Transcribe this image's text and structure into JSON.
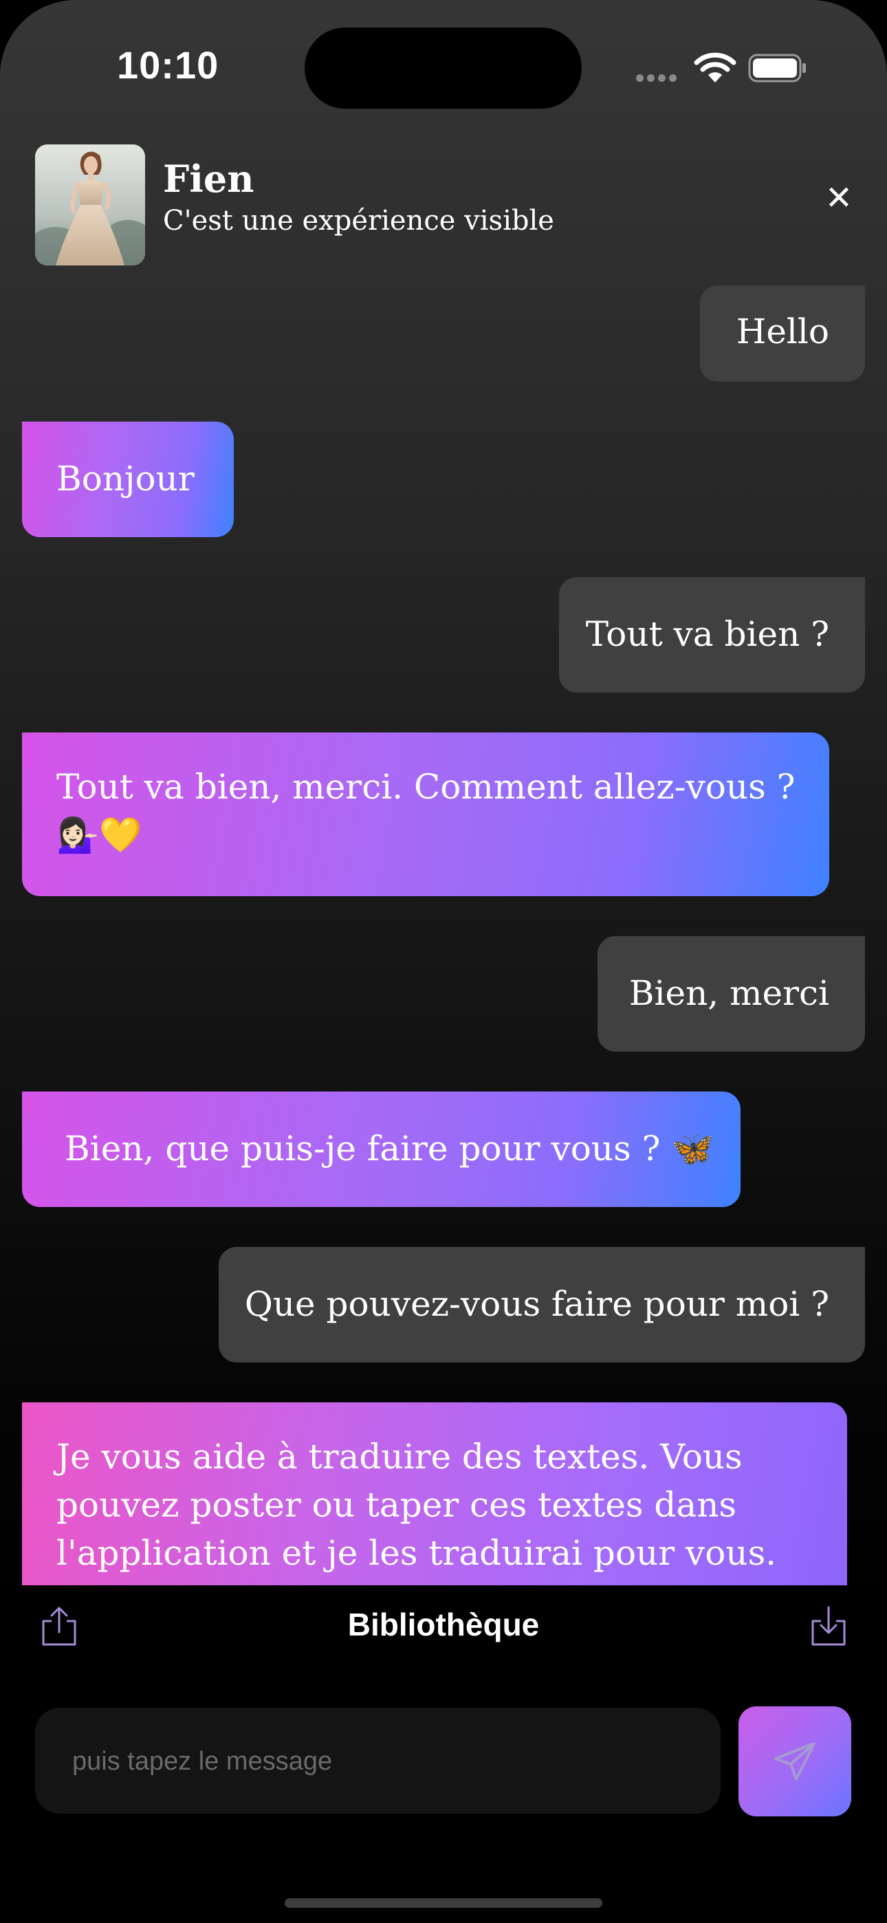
{
  "status_bar": {
    "time": "10:10"
  },
  "header": {
    "name": "Fien",
    "subtitle": "C'est une expérience visible",
    "close_symbol": "✕",
    "avatar_icon": "avatar-image-woman-dress"
  },
  "messages": [
    {
      "role": "user",
      "text": "Hello"
    },
    {
      "role": "bot",
      "text": "Bonjour"
    },
    {
      "role": "user",
      "text": "Tout va bien ?"
    },
    {
      "role": "bot",
      "text": "Tout va bien, merci. Comment allez-vous ?",
      "text2": "💁🏻‍♀️💛"
    },
    {
      "role": "user",
      "text": "Bien, merci"
    },
    {
      "role": "bot",
      "text": "Bien, que puis-je faire pour vous ? 🦋"
    },
    {
      "role": "user",
      "text": "Que pouvez-vous faire pour moi ?"
    },
    {
      "role": "bot",
      "text": "Je vous aide à traduire des textes. Vous",
      "text2": "pouvez poster ou taper ces textes dans",
      "text3": "l'application et je les traduirai pour vous."
    }
  ],
  "toolbar": {
    "library_label": "Bibliothèque",
    "share_icon": "share-icon",
    "download_icon": "download-icon"
  },
  "composer": {
    "placeholder": "puis tapez le message",
    "send_icon": "paper-plane-icon"
  },
  "colors": {
    "user_bubble": "#404040",
    "bot_gradient_start": "#d554e8",
    "bot_gradient_end": "#3f82ff",
    "background_top": "#363636",
    "background_bottom": "#000000"
  }
}
